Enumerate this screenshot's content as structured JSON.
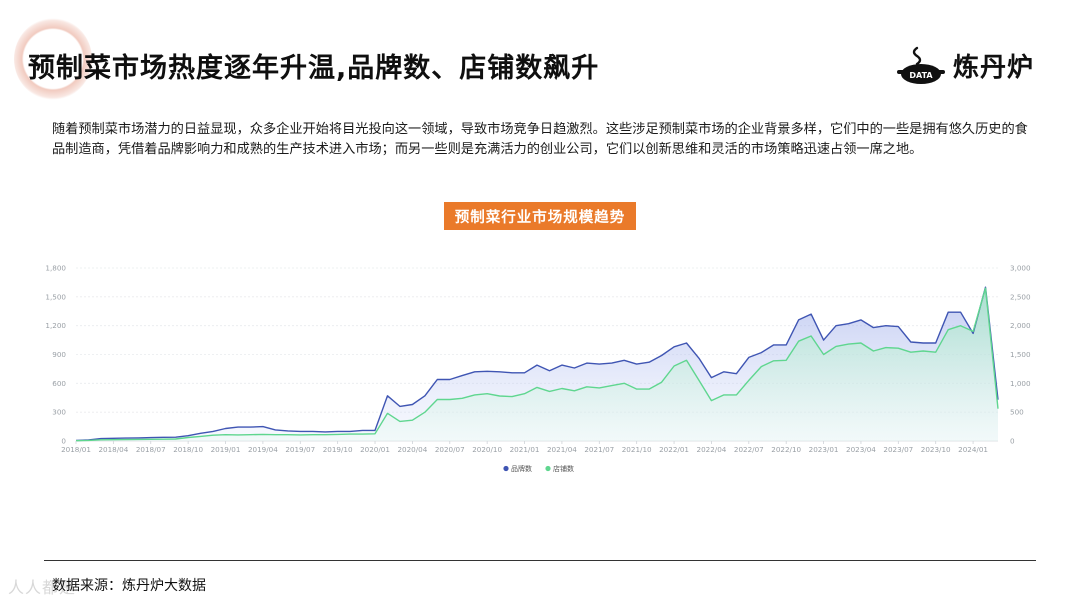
{
  "header": {
    "title": "预制菜市场热度逐年升温,品牌数、店铺数飙升",
    "logo_text": "炼丹炉",
    "logo_badge": "DATA"
  },
  "intro": {
    "text": "随着预制菜市场潜力的日益显现，众多企业开始将目光投向这一领域，导致市场竞争日趋激烈。这些涉足预制菜市场的企业背景多样，它们中的一些是拥有悠久历史的食品制造商，凭借着品牌影响力和成熟的生产技术进入市场；而另一些则是充满活力的创业公司，它们以创新思维和灵活的市场策略迅速占领一席之地。"
  },
  "footer": {
    "source": "数据来源：炼丹炉大数据",
    "watermark": "人人都是"
  },
  "colors": {
    "brand_series": "#3f55b3",
    "store_series": "#5fd68f",
    "title_badge": "#ea7a2a"
  },
  "chart_data": {
    "type": "area",
    "title": "预制菜行业市场规模趋势",
    "x_ticks": [
      "2018/01",
      "2018/04",
      "2018/07",
      "2018/10",
      "2019/01",
      "2019/04",
      "2019/07",
      "2019/10",
      "2020/01",
      "2020/04",
      "2020/07",
      "2020/10",
      "2021/01",
      "2021/04",
      "2021/07",
      "2021/10",
      "2022/01",
      "2022/04",
      "2022/07",
      "2022/10",
      "2023/01",
      "2023/04",
      "2023/07",
      "2023/10",
      "2024/01"
    ],
    "y_left": {
      "ticks": [
        0,
        300,
        600,
        900,
        1200,
        1500,
        1800
      ],
      "labels": [
        "0",
        "300",
        "600",
        "900",
        "1,200",
        "1,500",
        "1,800"
      ],
      "range": [
        0,
        1800
      ]
    },
    "y_right": {
      "ticks": [
        0,
        500,
        1000,
        1500,
        2000,
        2500,
        3000
      ],
      "labels": [
        "0",
        "500",
        "1,000",
        "1,500",
        "2,000",
        "2,500",
        "3,000"
      ],
      "range": [
        0,
        3000
      ]
    },
    "grid": true,
    "legend_position": "bottom-center",
    "series": [
      {
        "name": "品牌数",
        "axis": "left",
        "values": [
          5,
          10,
          25,
          28,
          30,
          32,
          35,
          38,
          40,
          55,
          80,
          100,
          130,
          145,
          145,
          150,
          115,
          105,
          100,
          100,
          95,
          100,
          100,
          110,
          110,
          470,
          360,
          380,
          470,
          640,
          640,
          680,
          720,
          725,
          720,
          710,
          710,
          790,
          730,
          790,
          760,
          810,
          800,
          810,
          840,
          800,
          820,
          890,
          980,
          1020,
          860,
          660,
          720,
          700,
          870,
          920,
          1000,
          1000,
          1260,
          1320,
          1050,
          1200,
          1220,
          1260,
          1180,
          1200,
          1190,
          1030,
          1020,
          1020,
          1340,
          1340,
          1120,
          1600,
          430
        ]
      },
      {
        "name": "店铺数",
        "axis": "right",
        "values": [
          5,
          10,
          20,
          22,
          25,
          28,
          30,
          32,
          35,
          60,
          80,
          100,
          110,
          105,
          110,
          115,
          110,
          110,
          105,
          110,
          110,
          115,
          120,
          120,
          125,
          480,
          340,
          360,
          500,
          720,
          720,
          740,
          800,
          820,
          780,
          770,
          820,
          930,
          860,
          910,
          870,
          940,
          920,
          960,
          1000,
          900,
          900,
          1020,
          1300,
          1400,
          1050,
          700,
          800,
          800,
          1050,
          1290,
          1390,
          1400,
          1730,
          1820,
          1500,
          1640,
          1680,
          1700,
          1560,
          1620,
          1610,
          1540,
          1560,
          1540,
          1930,
          2000,
          1900,
          2650,
          560
        ]
      }
    ]
  }
}
